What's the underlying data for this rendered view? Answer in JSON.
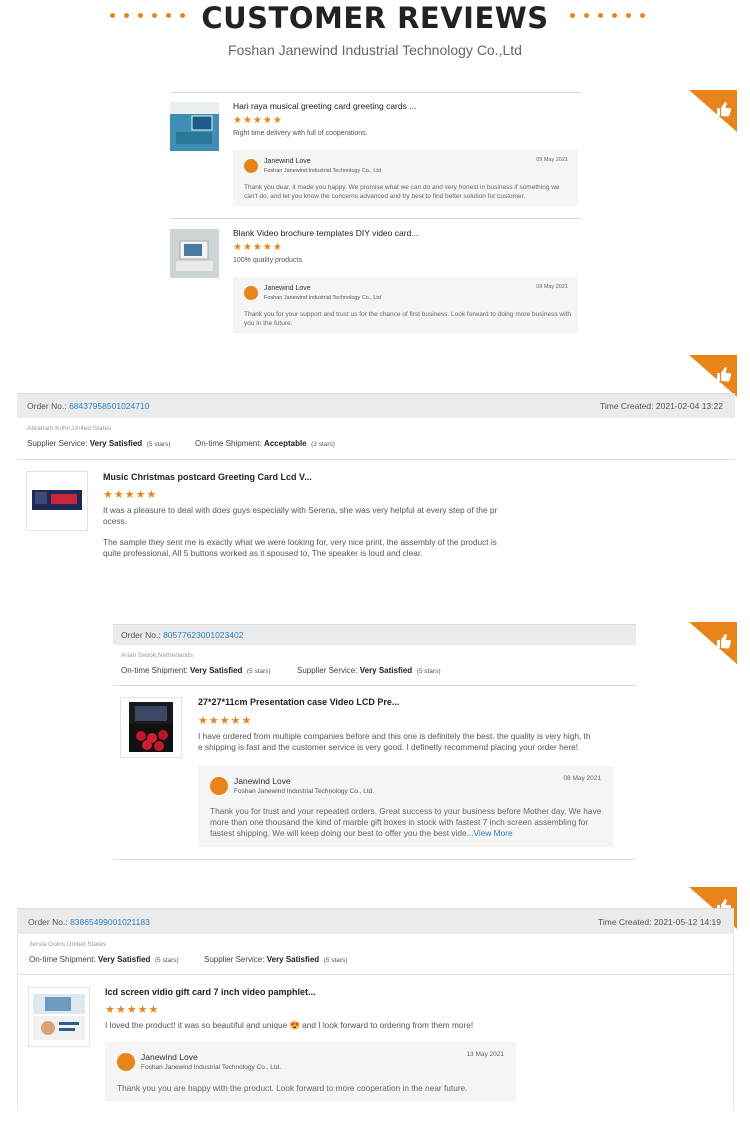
{
  "header": {
    "title": "CUSTOMER REVIEWS",
    "subtitle": "Foshan Janewind Industrial Technology Co.,Ltd"
  },
  "stars": "★★★★★",
  "compact_reviews": [
    {
      "product": "Hari raya musical greeting card greeting cards ...",
      "text": "Right time delivery with full of cooperations.",
      "reply": {
        "name": "Janewind Love",
        "company": "Foshan Janewind Industrial Technology Co., Ltd",
        "date": "09 May 2021",
        "text": "Thank you dear. it made you happy. We promise what we can do and very honest in business if something we can't do,  and let you know the concerns advanced and try best to find better solution for customer."
      }
    },
    {
      "product": "Blank Video brochure templates DIY video card...",
      "text": "100% quality products.",
      "reply": {
        "name": "Janewind Love",
        "company": "Foshan Janewind Industrial Technology Co., Ltd",
        "date": "09 May 2021",
        "text": "Thank you for your support and trust us for the chance of first business. Look forward to doing more business with you in the future."
      }
    }
  ],
  "orders": [
    {
      "label": "Order No.:",
      "number": "68437958501024710",
      "time": "Time Created: 2021-02-04 13:22",
      "buyer": "Abraham Kohn,United States",
      "ratings": [
        {
          "label": "Supplier Service:",
          "value": "Very Satisfied",
          "stars": "(5 stars)"
        },
        {
          "label": "On-time Shipment:",
          "value": "Acceptable",
          "stars": "(3 stars)"
        }
      ],
      "product": "Music Christmas postcard Greeting Card Lcd V...",
      "text1": "It was a pleasure to deal with does guys especially with Serena, she was very helpful at every step of the pr",
      "text2": "ocess.",
      "text3": "The sample they sent me is exactly what we were looking for, very nice print, the assembly of the product is",
      "text4": "quite professional, All 5 buttons worked as it spoused to, The speaker is loud and clear."
    },
    {
      "label": "Order No.:",
      "number": "80577623001023402",
      "buyer": "Arian Sevok,Netherlands",
      "ratings": [
        {
          "label": "On-time Shipment:",
          "value": "Very Satisfied",
          "stars": "(5 stars)"
        },
        {
          "label": "Supplier Service:",
          "value": "Very Satisfied",
          "stars": "(5 stars)"
        }
      ],
      "product": "27*27*11cm Presentation case Video LCD Pre...",
      "text1": "I have ordered from multiple companies before and this one is definitely the best. the quality is very high, th",
      "text2": "e shipping is fast and the customer service is very good. I definetly recommend placing your order here!",
      "reply": {
        "name": "Janewind Love",
        "company": "Foshan Janewind Industrial Technology Co., Ltd.",
        "date": "08 May 2021",
        "line1": "Thank you for trust and your repeated orders. Great success to your business before Mother day. We have",
        "line2": "more than one thousand the kind of marble gift boxes in stock with fastest 7 inch screen assembling for",
        "line3": "fastest shipping. We will keep doing our best to offer you the best vide...",
        "more": "View More"
      }
    },
    {
      "label": "Order No.:",
      "number": "83865499001021183",
      "time": "Time Created: 2021-05-12 14:19",
      "buyer": "Jersia Goins,United States",
      "ratings": [
        {
          "label": "On-time Shipment:",
          "value": "Very Satisfied",
          "stars": "(5 stars)"
        },
        {
          "label": "Supplier Service:",
          "value": "Very Satisfied",
          "stars": "(5 stars)"
        }
      ],
      "product": "lcd screen vidio gift card 7 inch video pamphlet...",
      "text1": "I loved the product! it was so beautiful and unique 😍 and I look forward to ordering from them more!",
      "reply": {
        "name": "Janewind Love",
        "company": "Foshan Janewind Industrial Technology Co., Ltd.",
        "date": "13 May 2021",
        "text": "Thank you you are happy with the product. Look forward to more cooperation in the near future."
      }
    }
  ],
  "colors": {
    "accent": "#e8841a",
    "link": "#2f7fc1"
  }
}
